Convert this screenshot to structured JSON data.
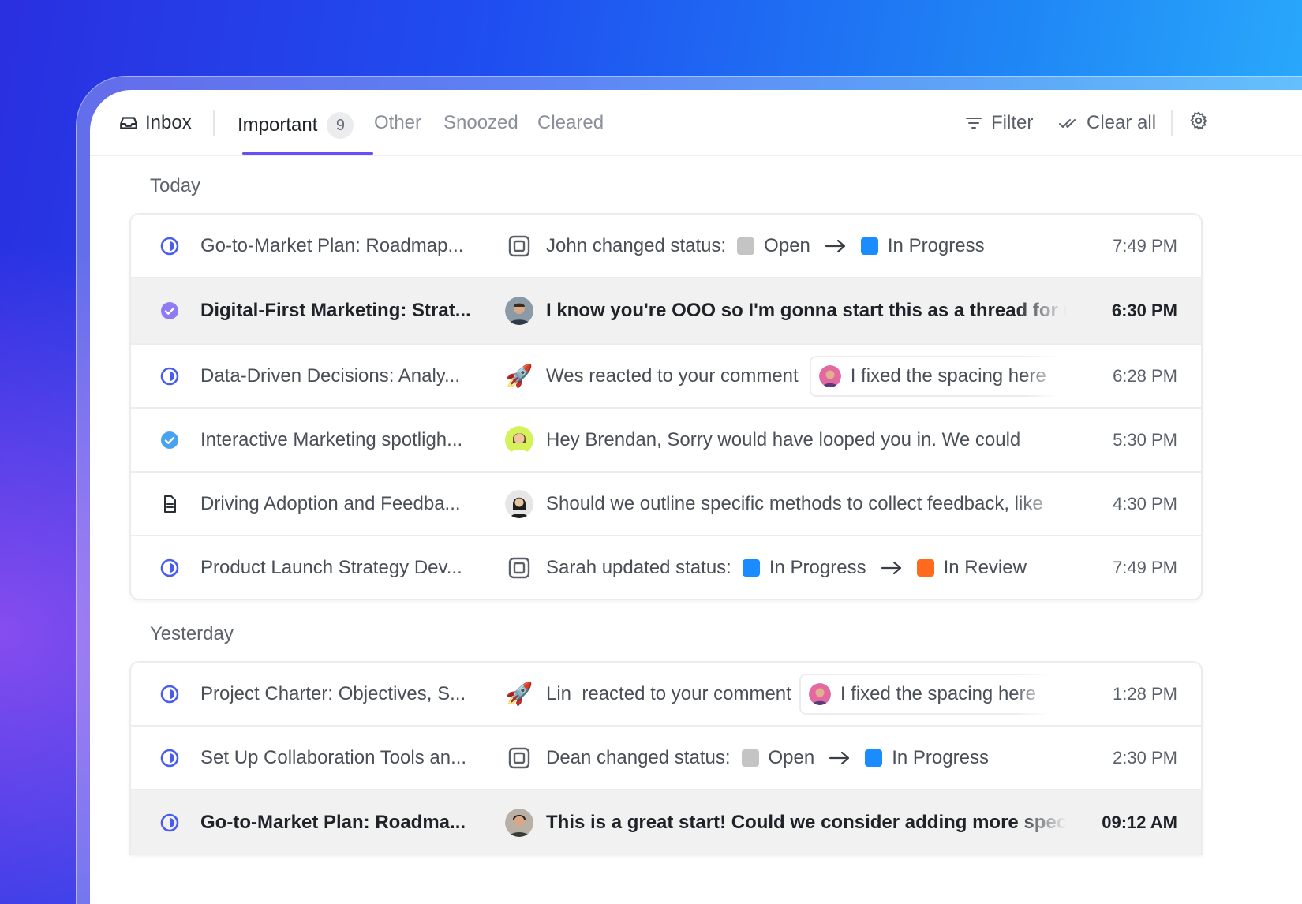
{
  "tabs": {
    "inbox": "Inbox",
    "important": "Important",
    "important_count": "9",
    "other": "Other",
    "snoozed": "Snoozed",
    "cleared": "Cleared"
  },
  "actions": {
    "filter": "Filter",
    "clear_all": "Clear all"
  },
  "colors": {
    "accent": "#6a4df4",
    "open": "#c4c4c4",
    "in_progress": "#1a8cff",
    "in_review": "#ff6a1f"
  },
  "sections": {
    "today": "Today",
    "yesterday": "Yesterday"
  },
  "today_rows": [
    {
      "title": "Go-to-Market Plan: Roadmap...",
      "actor": "John changed status:",
      "from": "Open",
      "to": "In Progress",
      "time": "7:49 PM"
    },
    {
      "title": "Digital-First Marketing: Strat...",
      "message": "I know you're OOO so I'm gonna start this as a thread for m",
      "time": "6:30 PM"
    },
    {
      "title": "Data-Driven Decisions: Analy...",
      "message": "Wes reacted to your comment",
      "chip": "I fixed the spacing here",
      "time": "6:28 PM"
    },
    {
      "title": "Interactive Marketing spotligh...",
      "message": "Hey Brendan, Sorry would have looped you in. We could",
      "time": "5:30 PM"
    },
    {
      "title": "Driving Adoption and Feedba...",
      "message": "Should we outline specific methods to collect feedback, like",
      "time": "4:30 PM"
    },
    {
      "title": "Product Launch Strategy Dev...",
      "actor": "Sarah updated status:",
      "from": "In Progress",
      "to": "In Review",
      "time": "7:49 PM"
    }
  ],
  "yesterday_rows": [
    {
      "title": "Project Charter: Objectives, S...",
      "message": "Lin  reacted to your comment",
      "chip": "I fixed the spacing here",
      "time": "1:28 PM"
    },
    {
      "title": "Set Up Collaboration Tools an...",
      "actor": "Dean changed status:",
      "from": "Open",
      "to": "In Progress",
      "time": "2:30 PM"
    },
    {
      "title": "Go-to-Market Plan: Roadma...",
      "message": "This is a great start! Could we consider adding more speci",
      "time": "09:12 AM"
    }
  ]
}
